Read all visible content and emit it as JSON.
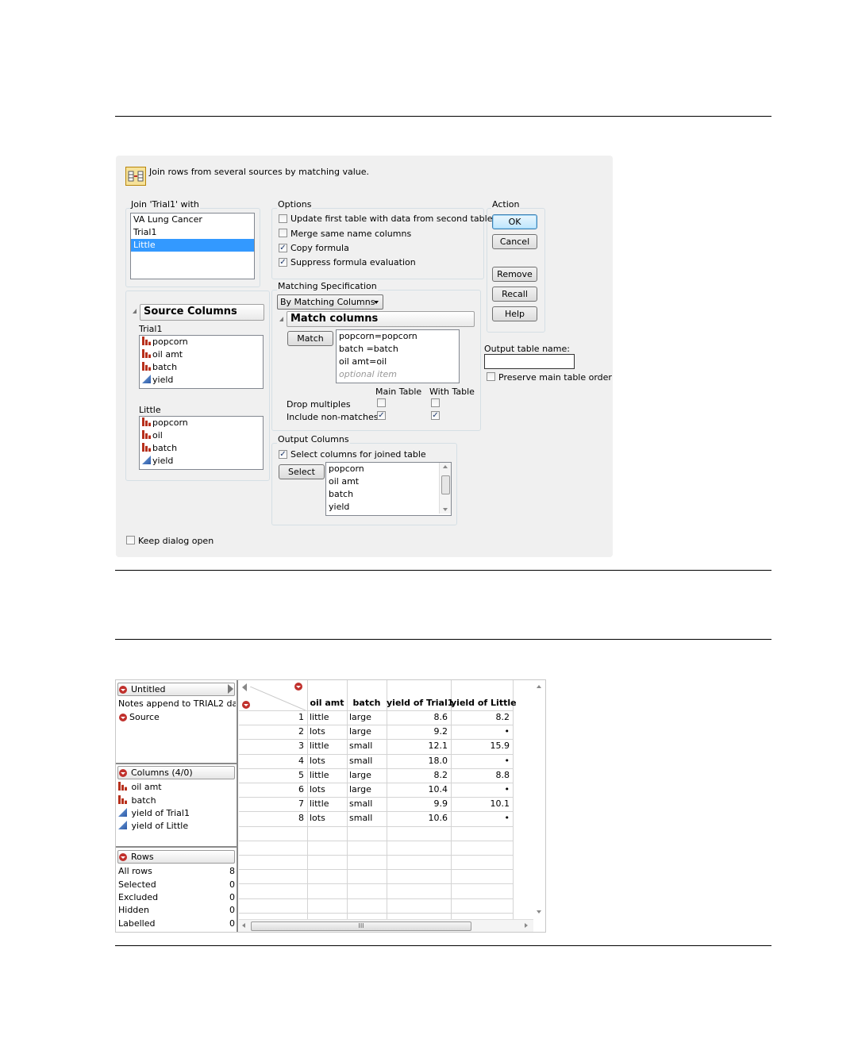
{
  "dialog": {
    "header_text": "Join rows from several sources by matching value.",
    "join_with": {
      "legend": "Join 'Trial1' with",
      "items": [
        "VA Lung Cancer",
        "Trial1",
        "Little"
      ],
      "selected": "Little"
    },
    "source_columns": {
      "title": "Source Columns",
      "table1_label": "Trial1",
      "table1_columns": [
        {
          "name": "popcorn",
          "icon": "nominal-bar-icon"
        },
        {
          "name": "oil amt",
          "icon": "nominal-bar-icon"
        },
        {
          "name": "batch",
          "icon": "nominal-bar-icon"
        },
        {
          "name": "yield",
          "icon": "continuous-triangle-icon"
        }
      ],
      "table2_label": "Little",
      "table2_columns": [
        {
          "name": "popcorn",
          "icon": "nominal-bar-icon"
        },
        {
          "name": "oil",
          "icon": "nominal-bar-icon"
        },
        {
          "name": "batch",
          "icon": "nominal-bar-icon"
        },
        {
          "name": "yield",
          "icon": "continuous-triangle-icon"
        }
      ]
    },
    "options": {
      "legend": "Options",
      "update_first": {
        "label": "Update first table with data from second table",
        "checked": false
      },
      "merge_same": {
        "label": "Merge same name columns",
        "checked": false
      },
      "copy_formula": {
        "label": "Copy formula",
        "checked": true
      },
      "suppress_formula": {
        "label": "Suppress formula evaluation",
        "checked": true
      }
    },
    "matching": {
      "legend": "Matching Specification",
      "method": "By Matching Columns",
      "match_columns_title": "Match columns",
      "match_button": "Match",
      "pairs": [
        "popcorn=popcorn",
        "batch =batch",
        "oil amt=oil"
      ],
      "optional_item": "optional item",
      "main_table_label": "Main Table",
      "with_table_label": "With Table",
      "drop_multiples_label": "Drop multiples",
      "include_nonmatches_label": "Include non-matches",
      "drop_multiples": {
        "main": false,
        "with": false
      },
      "include_nonmatches": {
        "main": true,
        "with": true
      }
    },
    "output_columns": {
      "legend": "Output Columns",
      "select_label": "Select columns for joined table",
      "select_checked": true,
      "select_button": "Select",
      "items": [
        "popcorn",
        "oil amt",
        "batch",
        "yield"
      ]
    },
    "action": {
      "legend": "Action",
      "ok": "OK",
      "cancel": "Cancel",
      "remove": "Remove",
      "recall": "Recall",
      "help": "Help"
    },
    "output_table_name_label": "Output table name:",
    "output_table_name_value": "",
    "preserve_order_label": "Preserve main table order",
    "preserve_order_checked": false,
    "keep_dialog_open_label": "Keep dialog open",
    "keep_dialog_open_checked": false
  },
  "datatable": {
    "table_panel": {
      "title": "Untitled",
      "notes": "Notes  append to TRIAL2 da",
      "source": "Source"
    },
    "columns_panel": {
      "title": "Columns (4/0)",
      "items": [
        {
          "name": "oil amt",
          "icon": "nominal-bar-icon"
        },
        {
          "name": "batch",
          "icon": "nominal-bar-icon"
        },
        {
          "name": "yield of Trial1",
          "icon": "continuous-triangle-icon"
        },
        {
          "name": "yield of Little",
          "icon": "continuous-triangle-icon"
        }
      ]
    },
    "rows_panel": {
      "title": "Rows",
      "items": [
        {
          "label": "All rows",
          "value": "8"
        },
        {
          "label": "Selected",
          "value": "0"
        },
        {
          "label": "Excluded",
          "value": "0"
        },
        {
          "label": "Hidden",
          "value": "0"
        },
        {
          "label": "Labelled",
          "value": "0"
        }
      ]
    },
    "headers": [
      "oil amt",
      "batch",
      "yield of Trial1",
      "yield of Little"
    ],
    "rows": [
      [
        "1",
        "little",
        "large",
        "8.6",
        "8.2"
      ],
      [
        "2",
        "lots",
        "large",
        "9.2",
        "•"
      ],
      [
        "3",
        "little",
        "small",
        "12.1",
        "15.9"
      ],
      [
        "4",
        "lots",
        "small",
        "18.0",
        "•"
      ],
      [
        "5",
        "little",
        "large",
        "8.2",
        "8.8"
      ],
      [
        "6",
        "lots",
        "large",
        "10.4",
        "•"
      ],
      [
        "7",
        "little",
        "small",
        "9.9",
        "10.1"
      ],
      [
        "8",
        "lots",
        "small",
        "10.6",
        "•"
      ]
    ],
    "hscroll_grip": "III"
  },
  "colors": {
    "dialog_bg": "#f0f0f0",
    "selection": "#3399ff",
    "nominal_icon": "#b7301c",
    "continuous_icon": "#2b5aa8",
    "red_dropdown": "#c0302c"
  }
}
